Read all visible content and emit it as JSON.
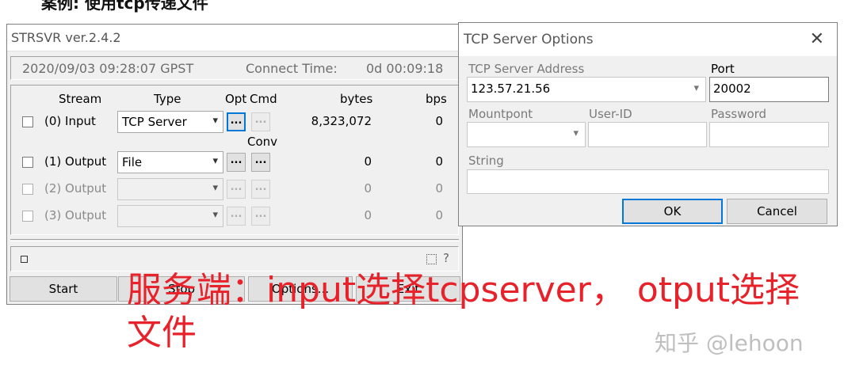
{
  "heading": "案例: 使用tcp传递文件",
  "strsvr": {
    "title": "STRSVR ver.2.4.2",
    "datetime": "2020/09/03 09:28:07 GPST",
    "connect_label": "Connect Time:",
    "connect_value": "0d 00:09:18",
    "headers": {
      "stream": "Stream",
      "type": "Type",
      "opt": "Opt",
      "cmd": "Cmd",
      "conv": "Conv",
      "bytes": "bytes",
      "bps": "bps"
    },
    "rows": [
      {
        "label": "(0) Input",
        "type": "TCP Server",
        "bytes": "8,323,072",
        "bps": "0",
        "enabled": true
      },
      {
        "label": "(1) Output",
        "type": "File",
        "bytes": "0",
        "bps": "0",
        "enabled": true
      },
      {
        "label": "(2) Output",
        "type": "",
        "bytes": "0",
        "bps": "0",
        "enabled": false
      },
      {
        "label": "(3) Output",
        "type": "",
        "bytes": "0",
        "bps": "0",
        "enabled": false
      }
    ],
    "btn_dots": "...",
    "help": "?",
    "buttons": {
      "start": "Start",
      "stop": "Stop",
      "options": "Options...",
      "exit": "Exit"
    }
  },
  "tcp": {
    "title": "TCP Server Options",
    "close": "✕",
    "addr_label": "TCP Server Address",
    "addr_value": "123.57.21.56",
    "port_label": "Port",
    "port_value": "20002",
    "mount_label": "Mountpont",
    "user_label": "User-ID",
    "pass_label": "Password",
    "string_label": "String",
    "ok": "OK",
    "cancel": "Cancel"
  },
  "caption": "服务端：input选择tcpserver， otput选择文件",
  "watermark": "知乎 @lehoon",
  "icons": {
    "dropdown": "▾"
  }
}
